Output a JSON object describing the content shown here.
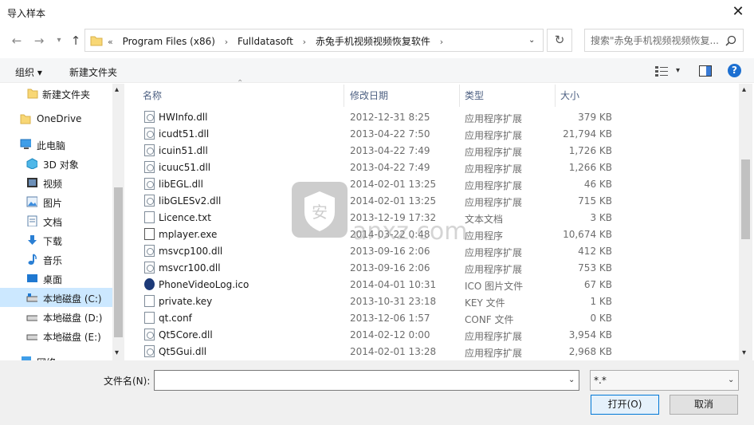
{
  "window": {
    "title": "导入样本"
  },
  "address": {
    "prefix": "«",
    "crumbs": [
      "Program Files (x86)",
      "Fulldatasoft",
      "赤兔手机视频视频恢复软件"
    ]
  },
  "search": {
    "placeholder": "搜索\"赤兔手机视频视频恢复..."
  },
  "toolbar": {
    "organize": "组织 ▾",
    "new_folder": "新建文件夹"
  },
  "sidebar": {
    "items": [
      {
        "label": "新建文件夹"
      },
      {
        "label": "OneDrive"
      },
      {
        "label": "此电脑"
      },
      {
        "label": "3D 对象"
      },
      {
        "label": "视频"
      },
      {
        "label": "图片"
      },
      {
        "label": "文档"
      },
      {
        "label": "下载"
      },
      {
        "label": "音乐"
      },
      {
        "label": "桌面"
      },
      {
        "label": "本地磁盘 (C:)"
      },
      {
        "label": "本地磁盘 (D:)"
      },
      {
        "label": "本地磁盘 (E:)"
      },
      {
        "label": "网络"
      }
    ]
  },
  "columns": {
    "name": "名称",
    "date": "修改日期",
    "type": "类型",
    "size": "大小"
  },
  "files": [
    {
      "name": "HWInfo.dll",
      "date": "2012-12-31 8:25",
      "type": "应用程序扩展",
      "size": "379 KB",
      "icon": "dll"
    },
    {
      "name": "icudt51.dll",
      "date": "2013-04-22 7:50",
      "type": "应用程序扩展",
      "size": "21,794 KB",
      "icon": "dll"
    },
    {
      "name": "icuin51.dll",
      "date": "2013-04-22 7:49",
      "type": "应用程序扩展",
      "size": "1,726 KB",
      "icon": "dll"
    },
    {
      "name": "icuuc51.dll",
      "date": "2013-04-22 7:49",
      "type": "应用程序扩展",
      "size": "1,266 KB",
      "icon": "dll"
    },
    {
      "name": "libEGL.dll",
      "date": "2014-02-01 13:25",
      "type": "应用程序扩展",
      "size": "46 KB",
      "icon": "dll"
    },
    {
      "name": "libGLESv2.dll",
      "date": "2014-02-01 13:25",
      "type": "应用程序扩展",
      "size": "715 KB",
      "icon": "dll"
    },
    {
      "name": "Licence.txt",
      "date": "2013-12-19 17:32",
      "type": "文本文档",
      "size": "3 KB",
      "icon": "txt"
    },
    {
      "name": "mplayer.exe",
      "date": "2014-03-22 0:48",
      "type": "应用程序",
      "size": "10,674 KB",
      "icon": "exe"
    },
    {
      "name": "msvcp100.dll",
      "date": "2013-09-16 2:06",
      "type": "应用程序扩展",
      "size": "412 KB",
      "icon": "dll"
    },
    {
      "name": "msvcr100.dll",
      "date": "2013-09-16 2:06",
      "type": "应用程序扩展",
      "size": "753 KB",
      "icon": "dll"
    },
    {
      "name": "PhoneVideoLog.ico",
      "date": "2014-04-01 10:31",
      "type": "ICO 图片文件",
      "size": "67 KB",
      "icon": "ico"
    },
    {
      "name": "private.key",
      "date": "2013-10-31 23:18",
      "type": "KEY 文件",
      "size": "1 KB",
      "icon": "txt"
    },
    {
      "name": "qt.conf",
      "date": "2013-12-06 1:57",
      "type": "CONF 文件",
      "size": "0 KB",
      "icon": "txt"
    },
    {
      "name": "Qt5Core.dll",
      "date": "2014-02-12 0:00",
      "type": "应用程序扩展",
      "size": "3,954 KB",
      "icon": "dll"
    },
    {
      "name": "Qt5Gui.dll",
      "date": "2014-02-01 13:28",
      "type": "应用程序扩展",
      "size": "2,968 KB",
      "icon": "dll"
    }
  ],
  "footer": {
    "filename_label": "文件名(N):",
    "filename_value": "",
    "filetype": "*.*",
    "open": "打开(O)",
    "cancel": "取消"
  },
  "watermark": {
    "text": "anxz.com",
    "badge": "安"
  }
}
